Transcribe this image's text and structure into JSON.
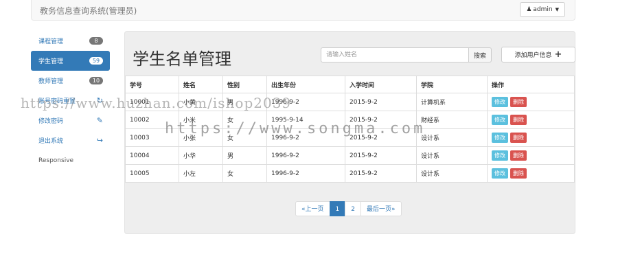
{
  "navbar": {
    "brand": "教务信息查询系统(管理员)",
    "user": "admin"
  },
  "sidebar": {
    "items": [
      {
        "label": "课程管理",
        "badge": "8"
      },
      {
        "label": "学生管理",
        "badge": "59"
      },
      {
        "label": "教师管理",
        "badge": "10"
      },
      {
        "label": "账号密码重置"
      },
      {
        "label": "修改密码"
      },
      {
        "label": "退出系统"
      },
      {
        "label": "Responsive"
      }
    ]
  },
  "main": {
    "title": "学生名单管理",
    "search": {
      "placeholder": "请输入姓名",
      "button": "搜索"
    },
    "add_button": "添加用户信息"
  },
  "table": {
    "headers": [
      "学号",
      "姓名",
      "性别",
      "出生年份",
      "入学时间",
      "学院",
      "操作"
    ],
    "rows": [
      [
        "10001",
        "小黄",
        "男",
        "1996-9-2",
        "2015-9-2",
        "计算机系"
      ],
      [
        "10002",
        "小米",
        "女",
        "1995-9-14",
        "2015-9-2",
        "财经系"
      ],
      [
        "10003",
        "小张",
        "女",
        "1996-9-2",
        "2015-9-2",
        "设计系"
      ],
      [
        "10004",
        "小华",
        "男",
        "1996-9-2",
        "2015-9-2",
        "设计系"
      ],
      [
        "10005",
        "小左",
        "女",
        "1996-9-2",
        "2015-9-2",
        "设计系"
      ]
    ],
    "edit_label": "修改",
    "delete_label": "删除"
  },
  "pagination": {
    "prev": "«上一页",
    "pages": [
      "1",
      "2"
    ],
    "last": "最后一页»"
  },
  "watermarks": {
    "top": "https://www.huzhan.com/ishop2039",
    "bottom": "https://www.songma.com"
  },
  "colors": {
    "primary": "#337ab7",
    "edit": "#5bc0de",
    "delete": "#d9534f"
  }
}
